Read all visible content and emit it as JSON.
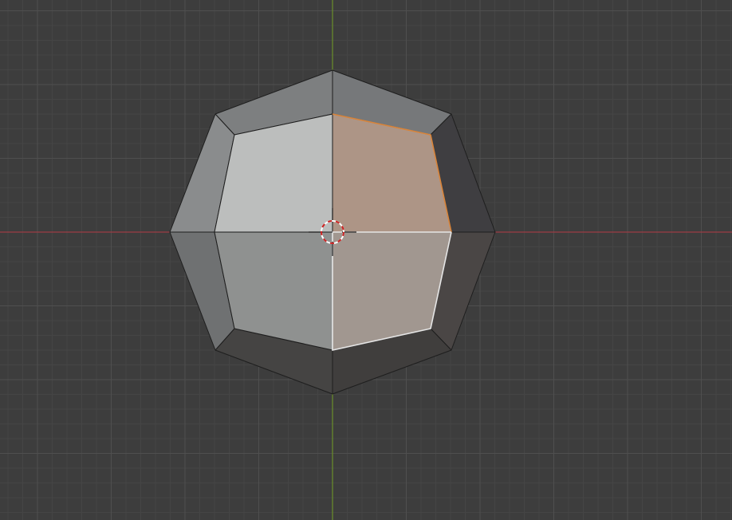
{
  "viewport": {
    "mode": "edit-mode",
    "view": "top-orthographic",
    "colors": {
      "background": "#3d3d3d",
      "grid_minor": "#454545",
      "grid_major": "#4f4f4f",
      "x_axis": "#9c3c44",
      "y_axis": "#6a8f2a",
      "selected_face": "#e0a184",
      "selection_edge": "#d9853b",
      "active_edge": "#f2f2f2"
    }
  },
  "mesh": {
    "object": "beveled-octagon",
    "selected_faces": 2,
    "ring_faces": 8,
    "inner_faces": 4
  },
  "cursor_3d": {
    "icon": "3d-cursor-icon",
    "colors": [
      "#ffffff",
      "#cc2222"
    ]
  }
}
